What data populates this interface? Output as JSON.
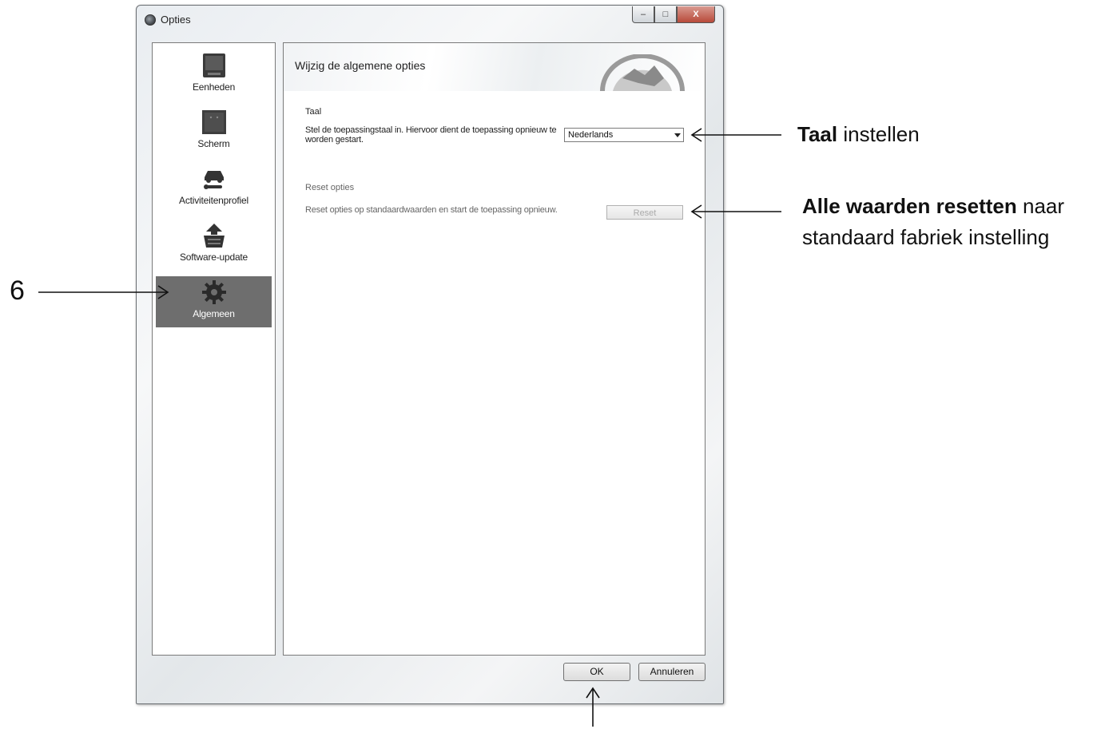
{
  "window": {
    "title": "Opties",
    "controls": {
      "minimize": "–",
      "maximize": "□",
      "close": "X"
    }
  },
  "sidebar": {
    "items": [
      {
        "label": "Eenheden",
        "icon": "device-icon",
        "active": false
      },
      {
        "label": "Scherm",
        "icon": "screen-icon",
        "active": false
      },
      {
        "label": "Activiteitenprofiel",
        "icon": "car-wrench-icon",
        "active": false
      },
      {
        "label": "Software-update",
        "icon": "update-basket-icon",
        "active": false
      },
      {
        "label": "Algemeen",
        "icon": "gear-icon",
        "active": true
      }
    ]
  },
  "content": {
    "title": "Wijzig de algemene opties",
    "language": {
      "heading": "Taal",
      "description": "Stel de toepassingstaal in. Hiervoor dient de toepassing opnieuw te worden gestart.",
      "selected": "Nederlands"
    },
    "reset": {
      "heading": "Reset opties",
      "description": "Reset opties op standaardwaarden en start de toepassing opnieuw.",
      "button": "Reset"
    }
  },
  "buttons": {
    "ok": "OK",
    "cancel": "Annuleren"
  },
  "annotations": {
    "marker": "6",
    "language_bold": "Taal",
    "language_rest": " instellen",
    "reset_bold": "Alle waarden resetten",
    "reset_rest": " naar",
    "reset_line2": "standaard fabriek instelling"
  },
  "colors": {
    "active_nav": "#6e6e6e",
    "frame": "#6b6f73"
  }
}
